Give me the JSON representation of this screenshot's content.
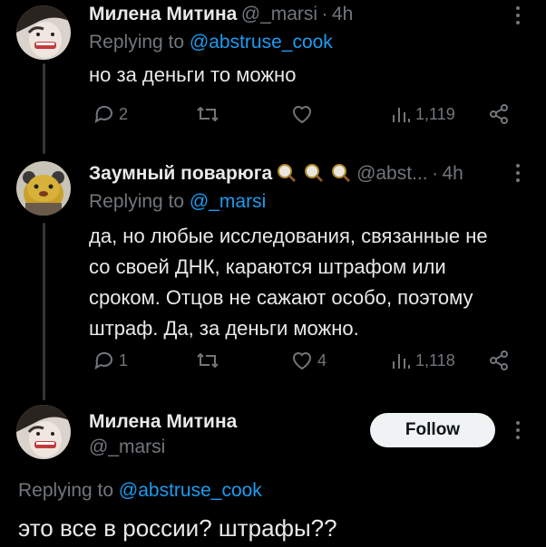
{
  "tweet1": {
    "name": "Милена Митина",
    "handle": "@_marsi",
    "sep": "·",
    "time": "4h",
    "replying_prefix": "Replying to",
    "replying_to": "@abstruse_cook",
    "text": "но за деньги то можно",
    "replies": "2",
    "views": "1,119"
  },
  "tweet2": {
    "name": "Заумный поварюга",
    "handle": "@abst...",
    "sep": "·",
    "time": "4h",
    "replying_prefix": "Replying to",
    "replying_to": "@_marsi",
    "text_lines": [
      "да, но любые исследования, связанные не",
      "со своей ДНК, караются штрафом или",
      "сроком. Отцов не сажают особо, поэтому",
      "штраф. Да, за деньги можно."
    ],
    "replies": "1",
    "likes": "4",
    "views": "1,118"
  },
  "tweet3": {
    "name": "Милена Митина",
    "handle": "@_marsi",
    "follow_label": "Follow",
    "replying_prefix": "Replying to",
    "replying_to": "@abstruse_cook",
    "text": "это все в россии? штрафы??"
  },
  "icons": {
    "reply": "reply-icon",
    "retweet": "retweet-icon",
    "like": "heart-icon",
    "views": "views-icon",
    "share": "share-icon",
    "more": "more-icon"
  },
  "colors": {
    "background": "#000000",
    "primary_text": "#e7e9ea",
    "muted_text": "#71767b",
    "link": "#1d9bf0",
    "follow_bg": "#eff3f4"
  }
}
